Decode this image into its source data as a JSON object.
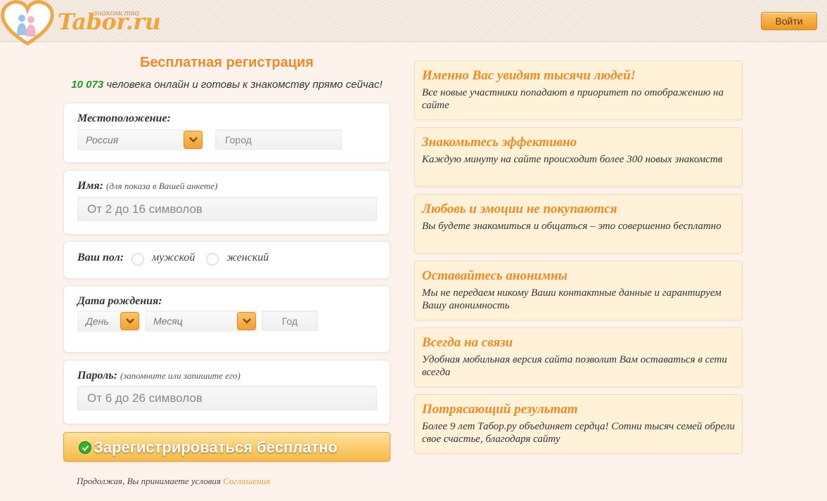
{
  "header": {
    "logo_small": "знакомства",
    "logo_text": "Tabor.ru",
    "login_label": "Войти"
  },
  "registration": {
    "title": "Бесплатная регистрация",
    "online_count": "10 073",
    "online_text": "человека онлайн и готовы к знакомству прямо сейчас!",
    "location": {
      "label": "Местоположение:",
      "country_value": "Россия",
      "city_placeholder": "Город"
    },
    "name": {
      "label": "Имя:",
      "hint": "(для показа в Вашей анкете)",
      "placeholder": "От 2 до 16 символов"
    },
    "gender": {
      "label": "Ваш пол:",
      "options": [
        "мужской",
        "женский"
      ]
    },
    "birthdate": {
      "label": "Дата рождения:",
      "day_placeholder": "День",
      "month_placeholder": "Месяц",
      "year_placeholder": "Год"
    },
    "password": {
      "label": "Пароль:",
      "hint": "(запомните или запишите его)",
      "placeholder": "От 6 до 26 символов"
    },
    "submit_label": "Зарегистрироваться бесплатно",
    "terms_text": "Продолжая, Вы принимаете условия",
    "terms_link": "Соглашения"
  },
  "features": [
    {
      "title": "Именно Вас увидят тысячи людей!",
      "text": "Все новые участники попадают в приоритет по отображению на сайте"
    },
    {
      "title": "Знакомьтесь эффективно",
      "text": "Каждую минуту на сайте происходит более 300 новых знакомств"
    },
    {
      "title": "Любовь и эмоции не покупаются",
      "text": "Вы будете знакомиться и общаться – это совершенно бесплатно"
    },
    {
      "title": "Оставайтесь анонимны",
      "text": "Мы не передаем никому Ваши контактные данные и гарантируем Вашу анонимность"
    },
    {
      "title": "Всегда на связи",
      "text": "Удобная мобильная версия сайта позволит Вам оставаться в сети всегда"
    },
    {
      "title": "Потрясающий результат",
      "text": "Более 9 лет Табор.ру объединяет сердца! Сотни тысяч семей обрели свое счастье, благодаря сайту"
    }
  ],
  "colors": {
    "accent": "#f0892a",
    "online_count": "#1e9b2a",
    "feature_bg": "#fff2d8",
    "page_bg": "#fdf3ec"
  },
  "icons": [
    "heart-logo-icon",
    "chevron-down-icon",
    "check-icon"
  ]
}
